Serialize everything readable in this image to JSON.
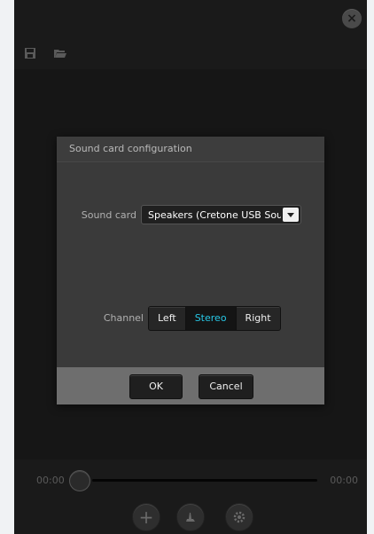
{
  "window": {
    "close_glyph": "×"
  },
  "toolbar": {
    "icons": [
      "save-icon",
      "folder-open-icon"
    ]
  },
  "timeline": {
    "start_time": "00:00",
    "end_time": "00:00",
    "position": 0
  },
  "bottom_bar": {
    "add_glyph": "+",
    "icons": [
      "add-icon",
      "marker-icon",
      "gear-icon"
    ]
  },
  "dialog": {
    "title": "Sound card configuration",
    "sound_card_label": "Sound card",
    "sound_card_value": "Speakers (Cretone USB Sound",
    "channel_label": "Channel",
    "channel_options": [
      "Left",
      "Stereo",
      "Right"
    ],
    "channel_selected": "Stereo",
    "ok_label": "OK",
    "cancel_label": "Cancel"
  },
  "colors": {
    "accent": "#27c7e6",
    "app_bg": "#1a1a1a",
    "dialog_bg": "#3a3a3a",
    "footer_bg": "#6e6e6e"
  }
}
